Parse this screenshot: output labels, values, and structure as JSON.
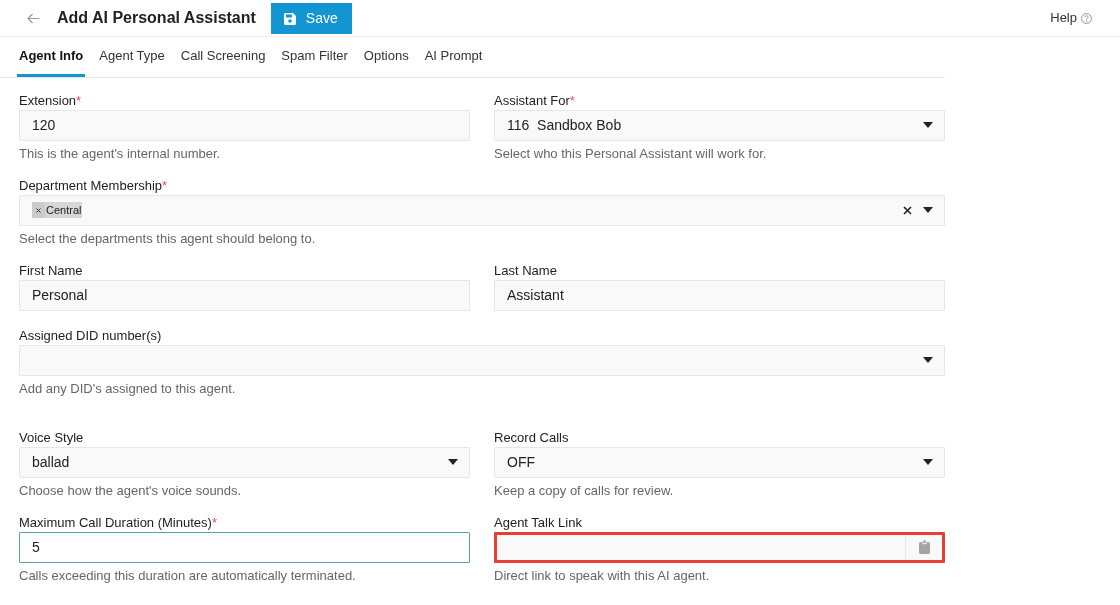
{
  "header": {
    "title": "Add AI Personal Assistant",
    "save_label": "Save",
    "help_label": "Help"
  },
  "tabs": [
    {
      "label": "Agent Info",
      "selected": true
    },
    {
      "label": "Agent Type",
      "selected": false
    },
    {
      "label": "Call Screening",
      "selected": false
    },
    {
      "label": "Spam Filter",
      "selected": false
    },
    {
      "label": "Options",
      "selected": false
    },
    {
      "label": "AI Prompt",
      "selected": false
    }
  ],
  "sections": [
    {
      "rows": [
        {
          "fields": [
            {
              "kind": "text",
              "label": "Extension",
              "required_mark": "*",
              "value": "120",
              "help": "This is the agent's internal number.",
              "focused": false,
              "highlighted": false
            },
            {
              "kind": "select",
              "label": "Assistant For",
              "required_mark": "*",
              "value": "116  Sandbox Bob",
              "help": "Select who this Personal Assistant will work for.",
              "focused": false,
              "highlighted": false
            }
          ]
        },
        {
          "fields": [
            {
              "kind": "tags",
              "label": "Department Membership",
              "required_mark": "*",
              "tags": [
                "Central"
              ],
              "help": "Select the departments this agent should belong to.",
              "focused": false,
              "highlighted": false
            }
          ]
        },
        {
          "fields": [
            {
              "kind": "text",
              "label": "First Name",
              "value": "Personal",
              "focused": false,
              "highlighted": false
            },
            {
              "kind": "text",
              "label": "Last Name",
              "value": "Assistant",
              "focused": false,
              "highlighted": false
            }
          ]
        },
        {
          "fields": [
            {
              "kind": "select",
              "label": "Assigned DID number(s)",
              "help": "Add any DID's assigned to this agent.",
              "focused": false,
              "highlighted": false
            }
          ]
        }
      ]
    },
    {
      "rows": [
        {
          "fields": [
            {
              "kind": "select",
              "label": "Voice Style",
              "value": "ballad",
              "help": "Choose how the agent's voice sounds.",
              "focused": false,
              "highlighted": false
            },
            {
              "kind": "select",
              "label": "Record Calls",
              "value": "OFF",
              "help": "Keep a copy of calls for review.",
              "focused": false,
              "highlighted": false
            }
          ]
        },
        {
          "fields": [
            {
              "kind": "text",
              "label": "Maximum Call Duration (Minutes)",
              "required_mark": "*",
              "value": "5",
              "help": "Calls exceeding this duration are automatically terminated.",
              "focused": true,
              "highlighted": false
            },
            {
              "kind": "link",
              "label": "Agent Talk Link",
              "help": "Direct link to speak with this AI agent.",
              "focused": false,
              "highlighted": true
            }
          ]
        }
      ]
    }
  ]
}
